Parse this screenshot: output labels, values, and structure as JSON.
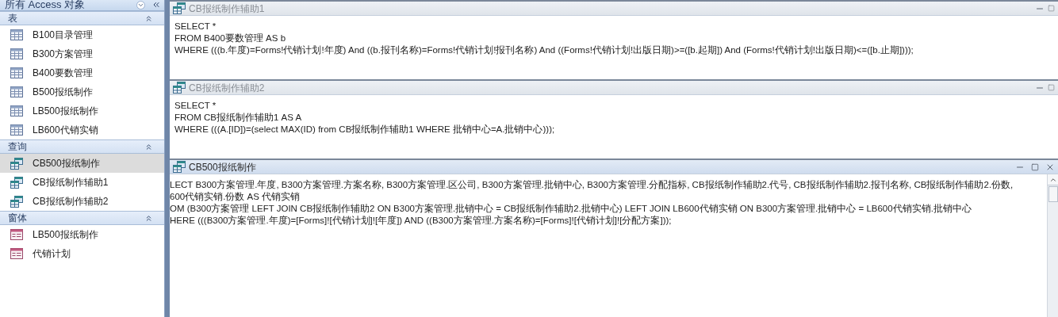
{
  "navigation_pane": {
    "title": "所有 Access 对象",
    "groups": [
      {
        "title": "表",
        "expanded": true,
        "items": [
          {
            "label": "B100目录管理",
            "kind": "table",
            "selected": false
          },
          {
            "label": "B300方案管理",
            "kind": "table",
            "selected": false
          },
          {
            "label": "B400要数管理",
            "kind": "table",
            "selected": false
          },
          {
            "label": "B500报纸制作",
            "kind": "table",
            "selected": false
          },
          {
            "label": "LB500报纸制作",
            "kind": "table",
            "selected": false
          },
          {
            "label": "LB600代销实销",
            "kind": "table",
            "selected": false
          }
        ]
      },
      {
        "title": "查询",
        "expanded": true,
        "items": [
          {
            "label": "CB500报纸制作",
            "kind": "query",
            "selected": true
          },
          {
            "label": "CB报纸制作辅助1",
            "kind": "query",
            "selected": false
          },
          {
            "label": "CB报纸制作辅助2",
            "kind": "query",
            "selected": false
          }
        ]
      },
      {
        "title": "窗体",
        "expanded": true,
        "items": [
          {
            "label": "LB500报纸制作",
            "kind": "form",
            "selected": false
          },
          {
            "label": "代销计划",
            "kind": "form",
            "selected": false
          }
        ]
      }
    ]
  },
  "windows": [
    {
      "title": "CB报纸制作辅助1",
      "active": false,
      "lines": [
        "SELECT *",
        "FROM B400要数管理 AS b",
        "WHERE (((b.年度)=Forms!代销计划!年度) And ((b.报刊名称)=Forms!代销计划!报刊名称) And ((Forms!代销计划!出版日期)>=([b.起期]) And (Forms!代销计划!出版日期)<=([b.止期])));"
      ]
    },
    {
      "title": "CB报纸制作辅助2",
      "active": false,
      "lines": [
        "SELECT *",
        "FROM CB报纸制作辅助1 AS A",
        "WHERE (((A.[ID])=(select MAX(ID) from CB报纸制作辅助1 WHERE 批销中心=A.批销中心)));"
      ]
    },
    {
      "title": "CB500报纸制作",
      "active": true,
      "lines": [
        "LECT B300方案管理.年度, B300方案管理.方案名称, B300方案管理.区公司, B300方案管理.批销中心, B300方案管理.分配指标, CB报纸制作辅助2.代号, CB报纸制作辅助2.报刊名称, CB报纸制作辅助2.份数,",
        "600代销实销.份数 AS 代销实销",
        "OM (B300方案管理 LEFT JOIN CB报纸制作辅助2 ON B300方案管理.批销中心 = CB报纸制作辅助2.批销中心) LEFT JOIN LB600代销实销 ON B300方案管理.批销中心 = LB600代销实销.批销中心",
        "HERE (((B300方案管理.年度)=[Forms]![代销计划]![年度]) AND ((B300方案管理.方案名称)=[Forms]![代销计划]![分配方案]));"
      ]
    }
  ]
}
